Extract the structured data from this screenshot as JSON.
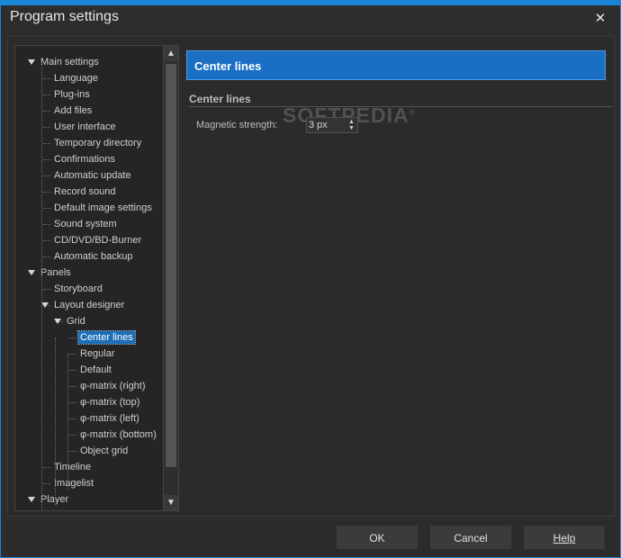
{
  "window": {
    "title": "Program settings",
    "close_glyph": "✕"
  },
  "tree": [
    {
      "label": "Main settings",
      "depth": 0,
      "expanded": true
    },
    {
      "label": "Language",
      "depth": 1
    },
    {
      "label": "Plug-ins",
      "depth": 1
    },
    {
      "label": "Add files",
      "depth": 1
    },
    {
      "label": "User interface",
      "depth": 1
    },
    {
      "label": "Temporary directory",
      "depth": 1
    },
    {
      "label": "Confirmations",
      "depth": 1
    },
    {
      "label": "Automatic update",
      "depth": 1
    },
    {
      "label": "Record sound",
      "depth": 1
    },
    {
      "label": "Default image settings",
      "depth": 1
    },
    {
      "label": "Sound system",
      "depth": 1
    },
    {
      "label": "CD/DVD/BD-Burner",
      "depth": 1
    },
    {
      "label": "Automatic backup",
      "depth": 1
    },
    {
      "label": "Panels",
      "depth": 0,
      "expanded": true
    },
    {
      "label": "Storyboard",
      "depth": 1
    },
    {
      "label": "Layout designer",
      "depth": 1,
      "expanded": true
    },
    {
      "label": "Grid",
      "depth": 2,
      "expanded": true
    },
    {
      "label": "Center lines",
      "depth": 3,
      "selected": true
    },
    {
      "label": "Regular",
      "depth": 3
    },
    {
      "label": "Default",
      "depth": 3
    },
    {
      "label": "φ-matrix (right)",
      "depth": 3
    },
    {
      "label": "φ-matrix (top)",
      "depth": 3
    },
    {
      "label": "φ-matrix (left)",
      "depth": 3
    },
    {
      "label": "φ-matrix (bottom)",
      "depth": 3
    },
    {
      "label": "Object grid",
      "depth": 3
    },
    {
      "label": "Timeline",
      "depth": 1
    },
    {
      "label": "Imagelist",
      "depth": 1
    },
    {
      "label": "Player",
      "depth": 0,
      "expanded": true
    }
  ],
  "scroll": {
    "up": "▲",
    "down": "▼"
  },
  "panel": {
    "header": "Center lines",
    "group_title": "Center lines",
    "field_label": "Magnetic strength:",
    "field_value": "3 px",
    "watermark": "SOFTPEDIA",
    "watermark_mark": "®"
  },
  "buttons": {
    "ok": "OK",
    "cancel": "Cancel",
    "help": "Help"
  },
  "colors": {
    "accent": "#1a84d6",
    "selection": "#1e6db8",
    "header": "#1a6fc4"
  }
}
